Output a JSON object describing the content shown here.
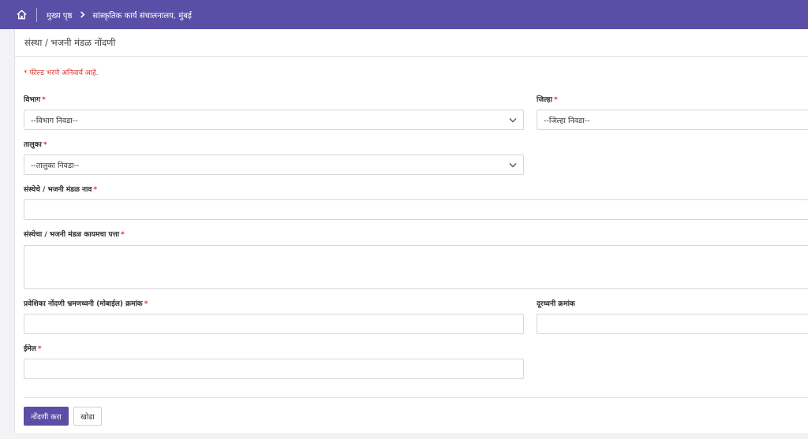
{
  "breadcrumb": {
    "home": "मुख्य पृष्ठ",
    "current": "सांस्कृतिक कार्य संचालनालय, मुंबई"
  },
  "form": {
    "title": "संस्था / भजनी मंडळ नोंदणी",
    "required_note": "* फील्ड भरणे अनिवार्य आहे.",
    "division": {
      "label": "विभाग",
      "value": "--विभाग निवडा--"
    },
    "district": {
      "label": "जिल्हा",
      "value": "--जिल्हा निवडा--"
    },
    "taluka": {
      "label": "तालुका",
      "value": "--तालुका निवडा--"
    },
    "org_name": {
      "label": "संस्थेचे / भजनी मंडळ नाव",
      "value": ""
    },
    "address": {
      "label": "संस्थेचा / भजनी मंडळ कायमचा पत्ता",
      "value": ""
    },
    "mobile": {
      "label": "प्रवेशिका नोंदणी भ्रमणध्वनी (मोबाईल) क्रमांक",
      "value": ""
    },
    "phone": {
      "label": "दूरध्वनी क्रमांक",
      "value": ""
    },
    "email": {
      "label": "ईमेल",
      "value": ""
    },
    "required_mark": "*",
    "submit_label": "नोंदणी करा",
    "reset_label": "खोडा"
  },
  "colors": {
    "primary": "#5a4ea6",
    "required": "#dd3333"
  }
}
